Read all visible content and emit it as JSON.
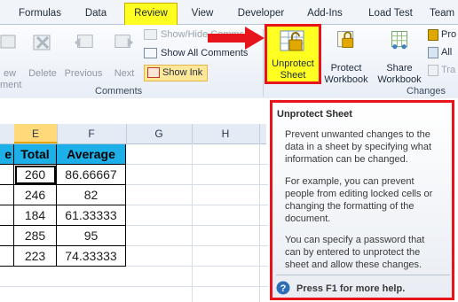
{
  "tabs": [
    {
      "label": "Formulas"
    },
    {
      "label": "Data"
    },
    {
      "label": "Review"
    },
    {
      "label": "View"
    },
    {
      "label": "Developer"
    },
    {
      "label": "Add-Ins"
    },
    {
      "label": "Load Test"
    },
    {
      "label": "Team"
    }
  ],
  "comments_group": {
    "label": "Comments",
    "buttons": [
      {
        "label": "ew",
        "label2": "ment"
      },
      {
        "label": "Delete"
      },
      {
        "label": "Previous"
      },
      {
        "label": "Next"
      }
    ],
    "show_hide_comment": "Show/Hide Comment",
    "show_all_comments": "Show All Comments",
    "show_ink": "Show Ink"
  },
  "changes_group": {
    "label": "Changes",
    "unprotect_sheet": {
      "line1": "Unprotect",
      "line2": "Sheet"
    },
    "protect_workbook": {
      "line1": "Protect",
      "line2": "Workbook"
    },
    "share_workbook": {
      "line1": "Share",
      "line2": "Workbook"
    },
    "side_items": [
      {
        "label": "Pro"
      },
      {
        "label": "All"
      },
      {
        "label": "Tra"
      }
    ]
  },
  "sheet": {
    "columns": [
      "E",
      "F",
      "G",
      "H"
    ],
    "partial_header": "e",
    "headers": {
      "total": "Total",
      "average": "Average"
    },
    "rows": [
      {
        "total": "260",
        "average": "86.66667"
      },
      {
        "total": "246",
        "average": "82"
      },
      {
        "total": "184",
        "average": "61.33333"
      },
      {
        "total": "285",
        "average": "95"
      },
      {
        "total": "223",
        "average": "74.33333"
      }
    ]
  },
  "tooltip": {
    "title": "Unprotect Sheet",
    "para1": [
      "Prevent unwanted changes to the",
      "data in a sheet by specifying what",
      "information can be changed."
    ],
    "para2": [
      "For example, you can prevent",
      "people from editing locked cells or",
      "changing the formatting of the",
      "document."
    ],
    "para3": [
      "You can specify a password that",
      "can by entered to unprotect the",
      "sheet and allow these changes."
    ],
    "help": "Press F1 for more help."
  },
  "colors": {
    "highlight": "#ffff22",
    "annotation": "#e8141c",
    "header_fill": "#1db0e8"
  }
}
